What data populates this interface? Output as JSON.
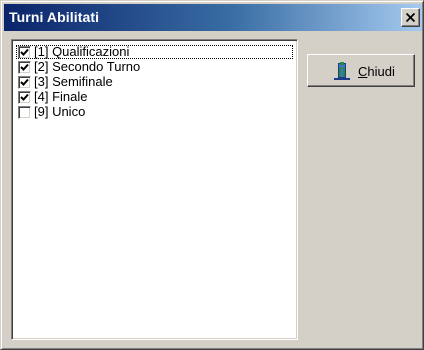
{
  "window": {
    "title": "Turni Abilitati",
    "close_icon": "close-x-icon"
  },
  "list": {
    "items": [
      {
        "label": "[1] Qualificazioni",
        "checked": true,
        "focused": true
      },
      {
        "label": "[2] Secondo Turno",
        "checked": true,
        "focused": false
      },
      {
        "label": "[3] Semifinale",
        "checked": true,
        "focused": false
      },
      {
        "label": "[4] Finale",
        "checked": true,
        "focused": false
      },
      {
        "label": "[9] Unico",
        "checked": false,
        "focused": false
      }
    ]
  },
  "chiudi_button": {
    "label": "Chiudi",
    "accelerator": "C",
    "label_rest": "hiudi",
    "icon": "door-exit-icon"
  },
  "colors": {
    "title_start": "#0a246a",
    "title_end": "#a6caf0",
    "face": "#d4d0c8",
    "icon_green": "#1f8f3a",
    "icon_blue": "#1e3a8a"
  }
}
